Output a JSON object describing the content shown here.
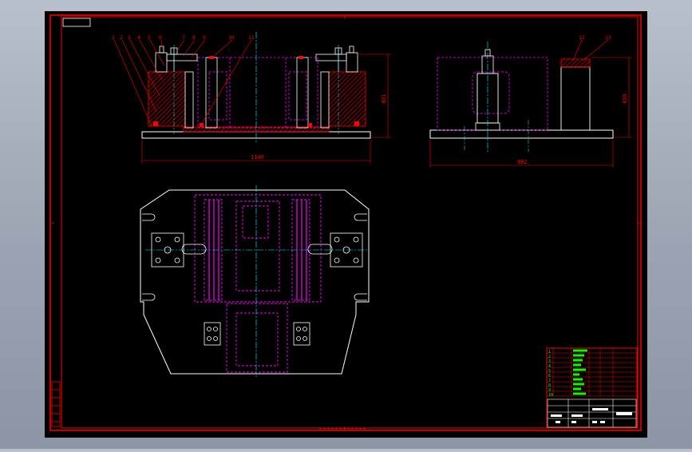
{
  "drawing": {
    "part_labels": [
      "1",
      "2",
      "3",
      "4",
      "5",
      "6",
      "7",
      "8",
      "9",
      "10",
      "11",
      "12",
      "13"
    ],
    "dimensions": {
      "front_width": "1140",
      "front_height": "401",
      "side_width": "902",
      "side_height": "430"
    }
  },
  "title_block": {
    "row_labels": [
      "1",
      "2",
      "3",
      "4",
      "5",
      "6",
      "7",
      "8",
      "9",
      "10"
    ]
  },
  "colors": {
    "border": "#ff0000",
    "sheet": "#000000",
    "outline": "#ffffff",
    "hidden_parts": "#ff00ff",
    "section": "#ff0000",
    "centerline": "#00ffff",
    "table_text": "#00ff00",
    "dimension": "#ff0000"
  }
}
